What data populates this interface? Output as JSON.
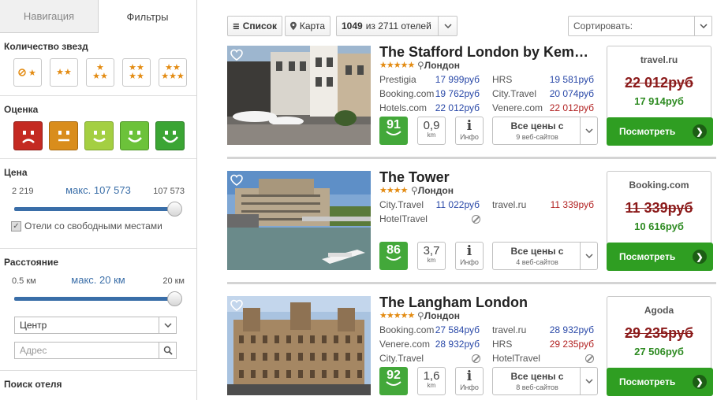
{
  "sidebar": {
    "tabs": [
      {
        "label": "Навигация"
      },
      {
        "label": "Фильтры"
      }
    ],
    "stars_title": "Количество звезд",
    "rating_title": "Оценка",
    "price": {
      "title": "Цена",
      "min": "2 219",
      "current": "макс. 107 573",
      "max": "107 573",
      "checkbox_label": "Отели со свободными местами"
    },
    "distance": {
      "title": "Расстояние",
      "min": "0.5 км",
      "current": "макс. 20 км",
      "max": "20 км",
      "select_value": "Центр",
      "address_placeholder": "Адрес"
    },
    "search_title": "Поиск отеля"
  },
  "toolbar": {
    "list_label": "Список",
    "map_label": "Карта",
    "count_bold": "1049",
    "count_rest": "из 2711 отелей",
    "sort_label": "Сортировать:"
  },
  "hotels": [
    {
      "name": "The Stafford London by Kem…",
      "stars": "★★★★★",
      "city": "Лондон",
      "prices_left": [
        {
          "site": "Prestigia",
          "price": "17 999руб"
        },
        {
          "site": "Booking.com",
          "price": "19 762руб"
        },
        {
          "site": "Hotels.com",
          "price": "22 012руб"
        }
      ],
      "prices_right": [
        {
          "site": "HRS",
          "price": "19 581руб"
        },
        {
          "site": "City.Travel",
          "price": "20 074руб"
        },
        {
          "site": "Venere.com",
          "price": "22 012руб"
        }
      ],
      "score": "91",
      "distance": "0,9",
      "distance_unit": "km",
      "info_label": "Инфо",
      "all_prices": "Все цены с",
      "sites_count": "9 веб-сайтов",
      "best_site": "travel.ru",
      "old_price": "22 012руб",
      "new_price": "17 914руб",
      "view_label": "Посмотреть"
    },
    {
      "name": "The Tower",
      "stars": "★★★★",
      "city": "Лондон",
      "prices_left": [
        {
          "site": "City.Travel",
          "price": "11 022руб"
        },
        {
          "site": "HotelTravel",
          "price": ""
        }
      ],
      "prices_right": [
        {
          "site": "travel.ru",
          "price": "11 339руб"
        }
      ],
      "score": "86",
      "distance": "3,7",
      "distance_unit": "km",
      "info_label": "Инфо",
      "all_prices": "Все цены с",
      "sites_count": "4 веб-сайтов",
      "best_site": "Booking.com",
      "old_price": "11 339руб",
      "new_price": "10 616руб",
      "view_label": "Посмотреть"
    },
    {
      "name": "The Langham London",
      "stars": "★★★★★",
      "city": "Лондон",
      "prices_left": [
        {
          "site": "Booking.com",
          "price": "27 584руб"
        },
        {
          "site": "Venere.com",
          "price": "28 932руб"
        },
        {
          "site": "City.Travel",
          "price": ""
        }
      ],
      "prices_right": [
        {
          "site": "travel.ru",
          "price": "28 932руб"
        },
        {
          "site": "HRS",
          "price": "29 235руб"
        },
        {
          "site": "HotelTravel",
          "price": ""
        }
      ],
      "score": "92",
      "distance": "1,6",
      "distance_unit": "km",
      "info_label": "Инфо",
      "all_prices": "Все цены с",
      "sites_count": "8 веб-сайтов",
      "best_site": "Agoda",
      "old_price": "29 235руб",
      "new_price": "27 506руб",
      "view_label": "Посмотреть"
    }
  ]
}
